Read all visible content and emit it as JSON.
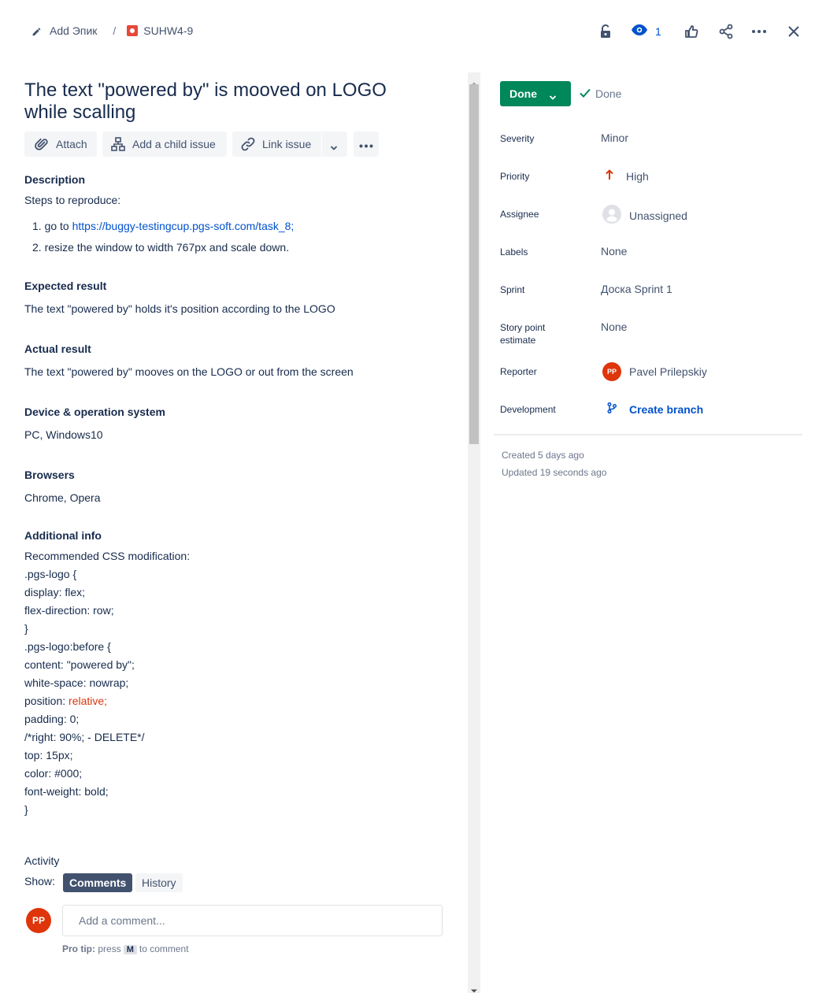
{
  "breadcrumb": {
    "epic_label": "Add Эпик",
    "separator": "/",
    "issue_key": "SUHW4-9"
  },
  "toolbar": {
    "watch_count": "1"
  },
  "issue": {
    "title": "The text \"powered by\" is mooved on LOGO while scalling"
  },
  "actions": {
    "attach": "Attach",
    "add_child": "Add a child issue",
    "link_issue": "Link issue"
  },
  "description": {
    "heading": "Description",
    "intro": "Steps to reproduce:",
    "step1_prefix": "go to ",
    "step1_link": "https://buggy-testingcup.pgs-soft.com/task_8;",
    "step2": "resize the window to width 767px and scale down.",
    "step1_num": "1.",
    "step2_num": "2."
  },
  "expected": {
    "heading": "Expected result",
    "text": "The text \"powered by\" holds it's position according to the LOGO"
  },
  "actual": {
    "heading": "Actual result",
    "text": "The text \"powered by\" mooves on the LOGO or out from the screen"
  },
  "device": {
    "heading": "Device & operation system",
    "text": "PC, Windows10"
  },
  "browsers": {
    "heading": "Browsers",
    "text": "Chrome, Opera"
  },
  "additional": {
    "heading": "Additional info",
    "intro": "Recommended CSS modification:",
    "lines": [
      {
        "text": ".pgs-logo {",
        "red": true
      },
      {
        "text": "display: flex;",
        "red": true
      },
      {
        "text": "flex-direction: row;",
        "red": true
      },
      {
        "text": "}",
        "red": true
      },
      {
        "text": ".pgs-logo:before {",
        "red": false
      },
      {
        "text": "content: \"powered by\";",
        "red": false
      },
      {
        "text": "white-space: nowrap;",
        "red": false
      },
      {
        "text": "position: ",
        "red": false,
        "suffix_red": "relative;"
      },
      {
        "text": "padding: 0;",
        "red": false
      },
      {
        "text": "/*right: 90%; - DELETE*/",
        "red": true
      },
      {
        "text": "top: 15px;",
        "red": false
      },
      {
        "text": "color: #000;",
        "red": false
      },
      {
        "text": "font-weight: bold;",
        "red": false
      },
      {
        "text": "}",
        "red": false
      }
    ]
  },
  "activity": {
    "heading": "Activity",
    "show_label": "Show:",
    "comments_tab": "Comments",
    "history_tab": "History",
    "avatar_initials": "PP",
    "comment_placeholder": "Add a comment...",
    "pro_tip_label": "Pro tip:",
    "pro_tip_press": "press",
    "pro_tip_key": "M",
    "pro_tip_suffix": "to comment"
  },
  "status": {
    "button_label": "Done",
    "resolution": "Done"
  },
  "fields": {
    "severity": {
      "label": "Severity",
      "value": "Minor"
    },
    "priority": {
      "label": "Priority",
      "value": "High"
    },
    "assignee": {
      "label": "Assignee",
      "value": "Unassigned"
    },
    "labels": {
      "label": "Labels",
      "value": "None"
    },
    "sprint": {
      "label": "Sprint",
      "value": "Доска Sprint 1"
    },
    "story_points": {
      "label_line1": "Story point",
      "label_line2": "estimate",
      "value": "None"
    },
    "reporter": {
      "label": "Reporter",
      "value": "Pavel Prilepskiy",
      "initials": "PP"
    },
    "development": {
      "label": "Development",
      "value": "Create branch"
    }
  },
  "meta": {
    "created": "Created 5 days ago",
    "updated": "Updated 19 seconds ago"
  },
  "colors": {
    "status_green": "#00875a",
    "priority_red": "#de350b",
    "link_blue": "#0052cc",
    "tab_active": "#42526e"
  }
}
